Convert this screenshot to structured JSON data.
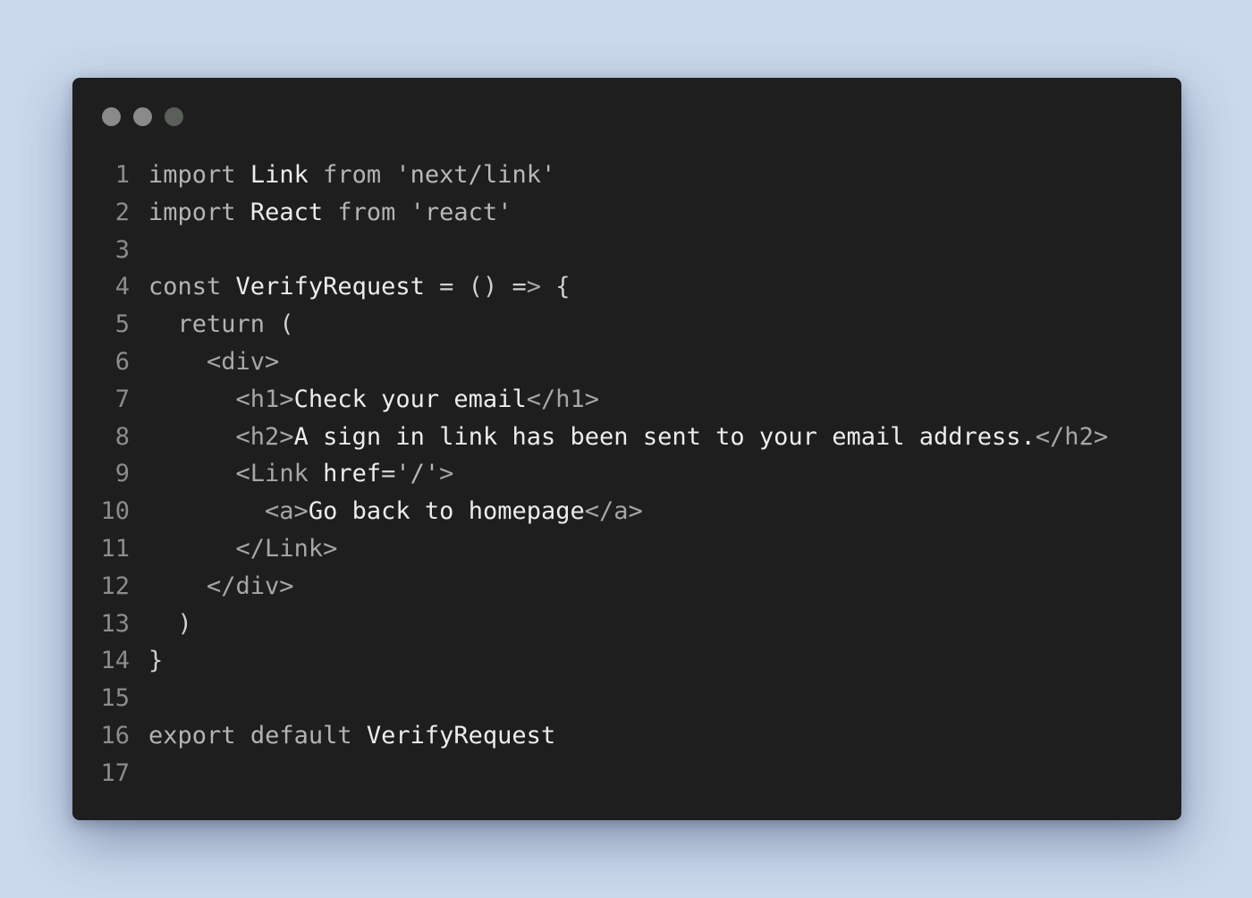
{
  "window": {
    "controls": [
      "window-dot-close",
      "window-dot-minimize",
      "window-dot-zoom"
    ]
  },
  "editor": {
    "lines": [
      {
        "number": "1",
        "text": "import Link from 'next/link'"
      },
      {
        "number": "2",
        "text": "import React from 'react'"
      },
      {
        "number": "3",
        "text": ""
      },
      {
        "number": "4",
        "text": "const VerifyRequest = () => {"
      },
      {
        "number": "5",
        "text": "  return ("
      },
      {
        "number": "6",
        "text": "    <div>"
      },
      {
        "number": "7",
        "text": "      <h1>Check your email</h1>"
      },
      {
        "number": "8",
        "text": "      <h2>A sign in link has been sent to your email address.</h2>"
      },
      {
        "number": "9",
        "text": "      <Link href='/'>"
      },
      {
        "number": "10",
        "text": "        <a>Go back to homepage</a>"
      },
      {
        "number": "11",
        "text": "      </Link>"
      },
      {
        "number": "12",
        "text": "    </div>"
      },
      {
        "number": "13",
        "text": "  )"
      },
      {
        "number": "14",
        "text": "}"
      },
      {
        "number": "15",
        "text": ""
      },
      {
        "number": "16",
        "text": "export default VerifyRequest"
      },
      {
        "number": "17",
        "text": ""
      }
    ]
  }
}
